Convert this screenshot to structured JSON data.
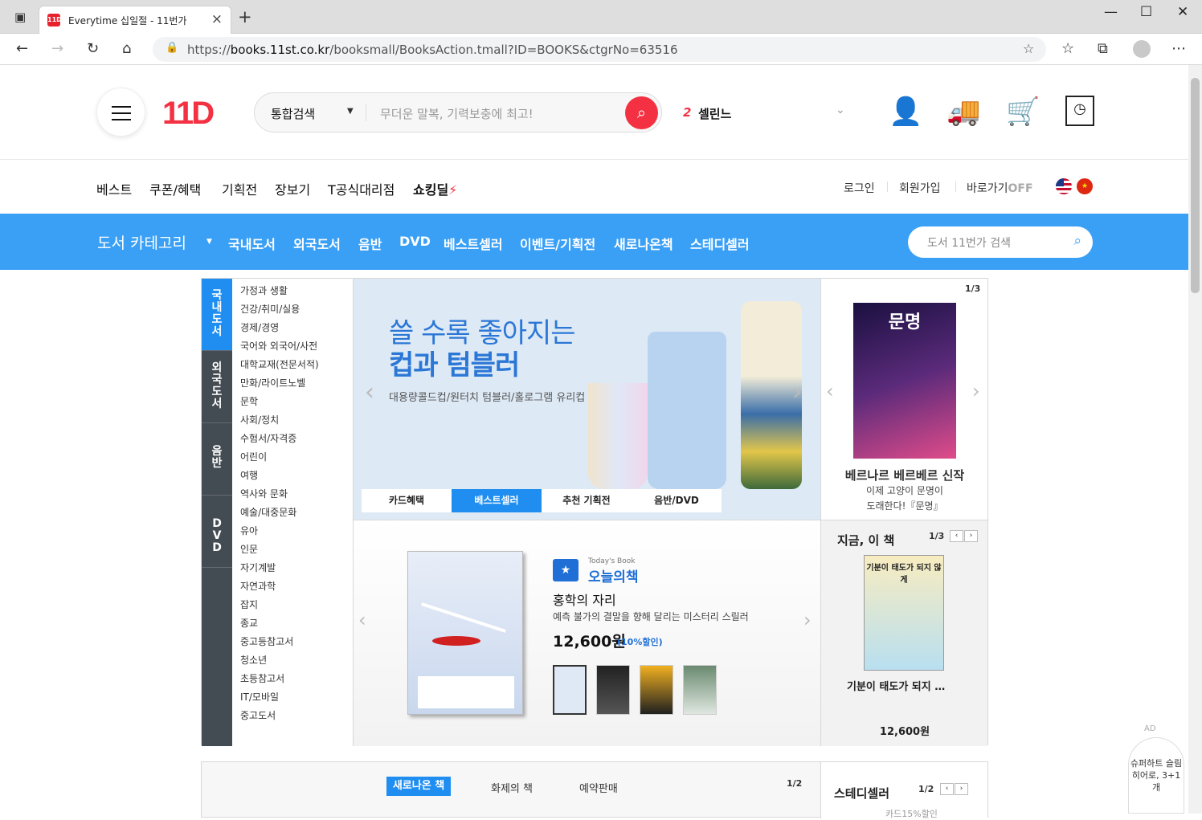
{
  "browser": {
    "tab_title": "Everytime 십일절 - 11번가",
    "tab_favicon": "11D",
    "url_prefix": "https://",
    "url_host": "books.11st.co.kr",
    "url_path": "/booksmall/BooksAction.tmall?ID=BOOKS&ctgrNo=63516",
    "icons": [
      "back-icon",
      "forward-icon",
      "reload-icon",
      "home-icon",
      "lock-icon",
      "favorite-add-icon",
      "favorites-icon",
      "collections-icon",
      "profile-icon",
      "more-icon",
      "minimize-icon",
      "maximize-icon",
      "close-icon"
    ]
  },
  "header": {
    "logo": "11D",
    "search_type": "통합검색",
    "search_placeholder": "무더운 말복, 기력보충에 최고!",
    "rank_num": "2",
    "rank_keyword": "셀린느",
    "accent": "#f43142"
  },
  "gnb": {
    "items": [
      "베스트",
      "쿠폰/혜택",
      "기획전",
      "장보기",
      "T공식대리점"
    ],
    "shocking_deal": "쇼킹딜",
    "login": "로그인",
    "signup": "회원가입",
    "shortcut": "바로가기",
    "shortcut_state": "OFF"
  },
  "books_nav": {
    "category_title": "도서 카테고리",
    "menu": [
      "국내도서",
      "외국도서",
      "음반",
      "DVD",
      "베스트셀러",
      "이벤트/기획전",
      "새로나온책",
      "스테디셀러"
    ],
    "search_placeholder": "도서 11번가 검색",
    "bar_color": "#3aa0f6"
  },
  "side_tabs": [
    "국\n내\n도\n서",
    "외\n국\n도\n서",
    "음\n반",
    "D\nV\nD"
  ],
  "categories": [
    "가정과 생활",
    "건강/취미/실용",
    "경제/경영",
    "국어와 외국어/사전",
    "대학교재(전문서적)",
    "만화/라이트노벨",
    "문학",
    "사회/정치",
    "수험서/자격증",
    "어린이",
    "여행",
    "역사와 문화",
    "예술/대중문화",
    "유아",
    "인문",
    "자기계발",
    "자연과학",
    "잡지",
    "종교",
    "중고등참고서",
    "청소년",
    "초등참고서",
    "IT/모바일",
    "중고도서"
  ],
  "hero": {
    "title1": "쓸 수록 좋아지는",
    "title2": "컵과 텀블러",
    "subtitle": "대용량콜드컵/원터치 텀블러/홀로그램 유리컵",
    "tabs": [
      "카드혜택",
      "베스트셀러",
      "추천 기획전",
      "음반/DVD"
    ],
    "active_tab": 1
  },
  "side_top": {
    "pager": "1/3",
    "book_cover_title": "문명",
    "caption1": "베르나르 베르베르 신작",
    "caption2": "이제 고양이 문명이",
    "caption3": "도래한다!『문명』"
  },
  "today": {
    "label_en": "Today's Book",
    "label_ko": "오늘의책",
    "title": "홍학의 자리",
    "desc": "예측 불가의 결말을 향해 달리는 미스터리 스릴러",
    "price": "12,600원",
    "discount": "(10%할인)"
  },
  "now_book": {
    "title": "지금, 이 책",
    "pager": "1/3",
    "cover_text": "기분이 태도가 되지 않게",
    "caption": "기분이 태도가 되지 …",
    "price": "12,600원"
  },
  "second_row": {
    "tabs": [
      "새로나온 책",
      "화제의 책",
      "예약판매"
    ],
    "pager": "1/2",
    "steady_title": "스테디셀러",
    "steady_pager": "1/2",
    "steady_partial": "카드15%할인"
  },
  "ad": {
    "label": "AD",
    "text": "슈퍼하트 슬림히어로, 3+1개"
  }
}
